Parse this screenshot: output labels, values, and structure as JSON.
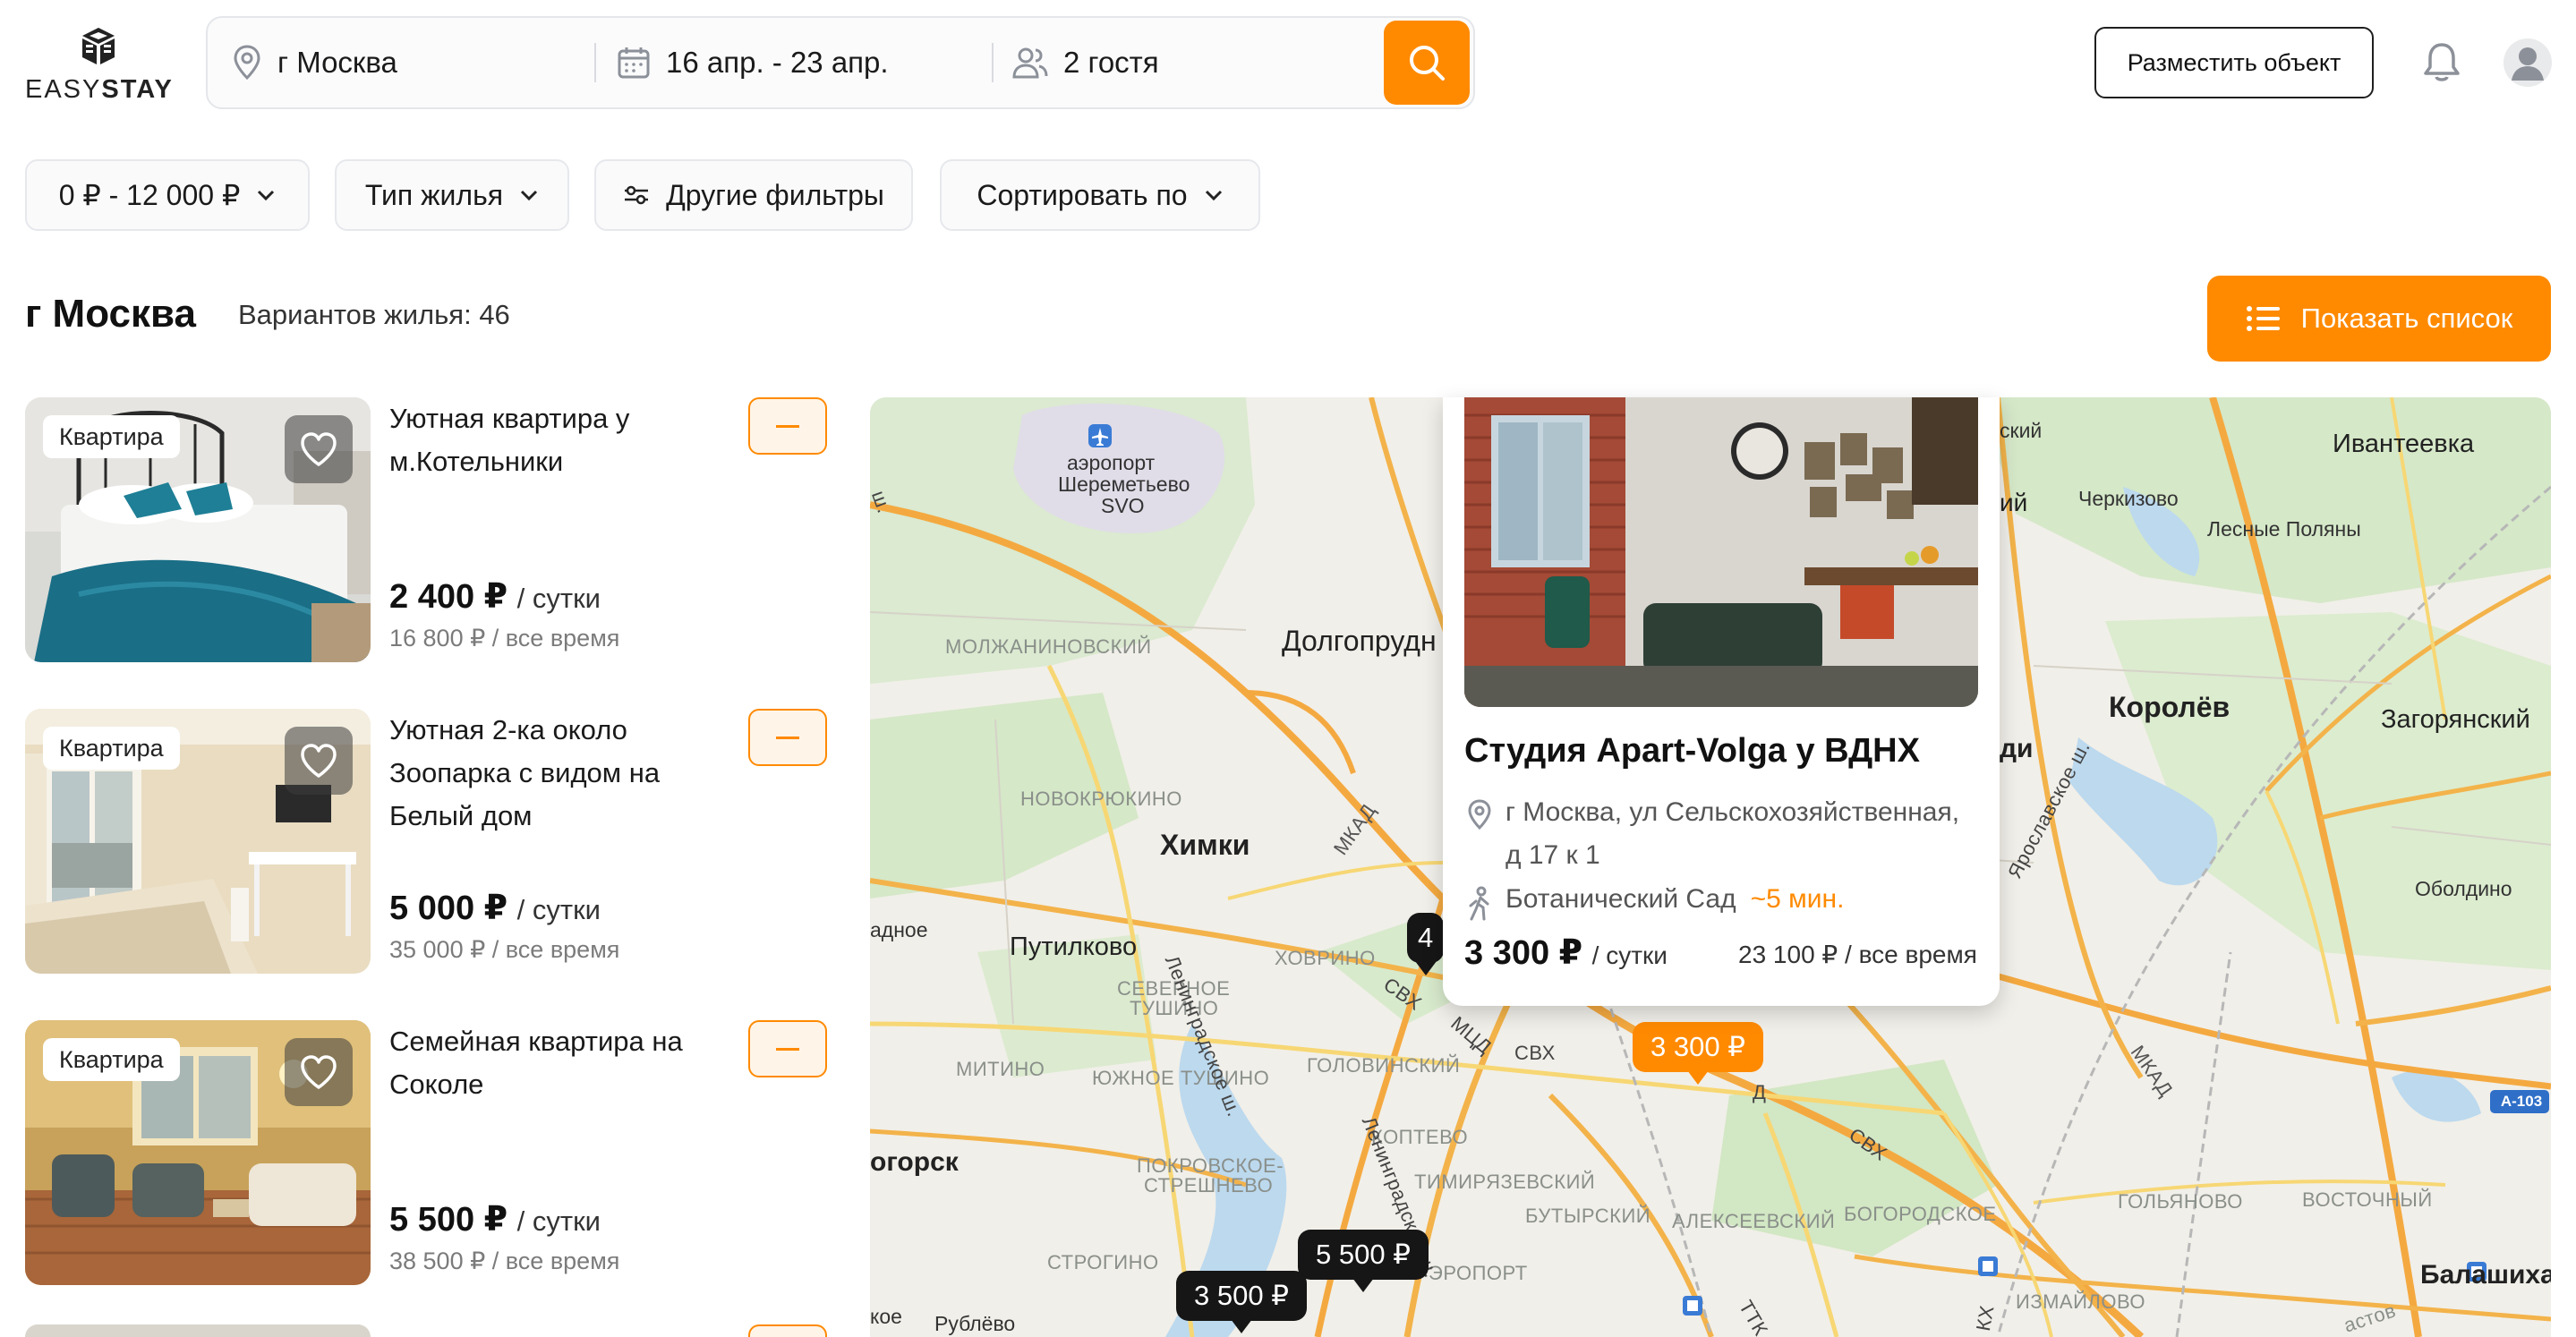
{
  "logo": {
    "text_light": "EASY",
    "text_bold": "STAY"
  },
  "search": {
    "location": "г Москва",
    "dates": "16 апр. - 23 апр.",
    "guests": "2 гостя"
  },
  "header": {
    "post_button": "Разместить объект"
  },
  "filters": {
    "price": "0 ₽ - 12 000 ₽",
    "type": "Тип жилья",
    "other": "Другие фильтры",
    "sort": "Сортировать по"
  },
  "results": {
    "city": "г Москва",
    "count_label": "Вариантов жилья: 46",
    "show_list": "Показать список"
  },
  "listings": [
    {
      "badge": "Квартира",
      "title": "Уютная квартира у м.Котельники",
      "price": "2 400 ₽",
      "per": "/ сутки",
      "total": "16 800 ₽ / все время"
    },
    {
      "badge": "Квартира",
      "title": "Уютная 2-ка около Зоопарка с видом на Белый дом",
      "price": "5 000 ₽",
      "per": "/ сутки",
      "total": "35 000 ₽ / все время"
    },
    {
      "badge": "Квартира",
      "title": "Семейная квартира на Соколе",
      "price": "5 500 ₽",
      "per": "/ сутки",
      "total": "38 500 ₽ / все время"
    }
  ],
  "map": {
    "labels": {
      "airport": "аэропорт",
      "airport2": "Шереметьево",
      "airport3": "SVO",
      "molzh": "МОЛЖАНИНОВСКИЙ",
      "dolgoprud": "Долгопрудн",
      "novokr": "НОВОКРЮКИНО",
      "khimki": "Химки",
      "mkad1": "МКАД",
      "putilkovo": "Путилково",
      "adnoe": "адное",
      "khovrino": "ХОВРИНО",
      "sev_tush": "СЕВЕРНОЕ",
      "sev_tush2": "ТУШИНО",
      "mitino": "МИТИНО",
      "yuzh_tush": "ЮЖНОЕ ТУШИНО",
      "golovinsky": "ГОЛОВИНСКИЙ",
      "koptevo": "КОПТЕВО",
      "pokrov": "ПОКРОВСКОЕ-",
      "pokrov2": "СТРЕШНЕВО",
      "timir": "ТИМИРЯЗЕВСКИЙ",
      "butyr": "БУТЫРСКИЙ",
      "alekseev": "АЛЕКСЕЕВСКИЙ",
      "bogorod": "БОГОРОДСКОЕ",
      "golyanovo": "ГОЛЬЯНОВО",
      "vostochny": "ВОСТОЧНЫЙ",
      "izmaylovo": "ИЗМАЙЛОВО",
      "strogino": "СТРОГИНО",
      "rublevo": "Рублёво",
      "ogorsk": "огорск",
      "koe": "кое",
      "oport": "ЭРОПОРТ",
      "ivanteevka": "Ивантеевка",
      "cherkizovo": "Черкизово",
      "lesnye": "Лесные Поляны",
      "korolev": "Королёв",
      "zagoryan": "Загорянский",
      "oboldino": "Оболдино",
      "balashikha": "Балашиха",
      "tskiy": "ский",
      "iy": "ий",
      "di": "ди",
      "a103": "А-103",
      "astov": "астов",
      "mkad2": "МКАД",
      "svh1": "СВХ",
      "svh2": "СВХ",
      "svh3": "СВХ",
      "mtsd": "МЦД",
      "leningr": "Ленинградское ш.",
      "leningr2": "Ленинградское ш.",
      "yarosl": "Ярославское ш.",
      "sh": "ш.",
      "ttk": "ТТК",
      "kh": "КХ",
      "d_letter": "Д"
    },
    "pins": {
      "p_main": "3 300 ₽",
      "p_5500": "5 500 ₽",
      "p_3500": "3 500 ₽",
      "p_hidden": "4"
    }
  },
  "popup": {
    "title": "Студия Apart-Volga у ВДНХ",
    "address": "г Москва, ул Сельскохозяйственная, д 17 к 1",
    "metro": "Ботанический Сад",
    "walk": "~5 мин.",
    "price": "3 300 ₽",
    "per": "/ сутки",
    "total": "23 100 ₽ / все время"
  },
  "colors": {
    "accent": "#ff8a00",
    "text": "#1a1a1a",
    "muted": "#7b7b7b"
  }
}
